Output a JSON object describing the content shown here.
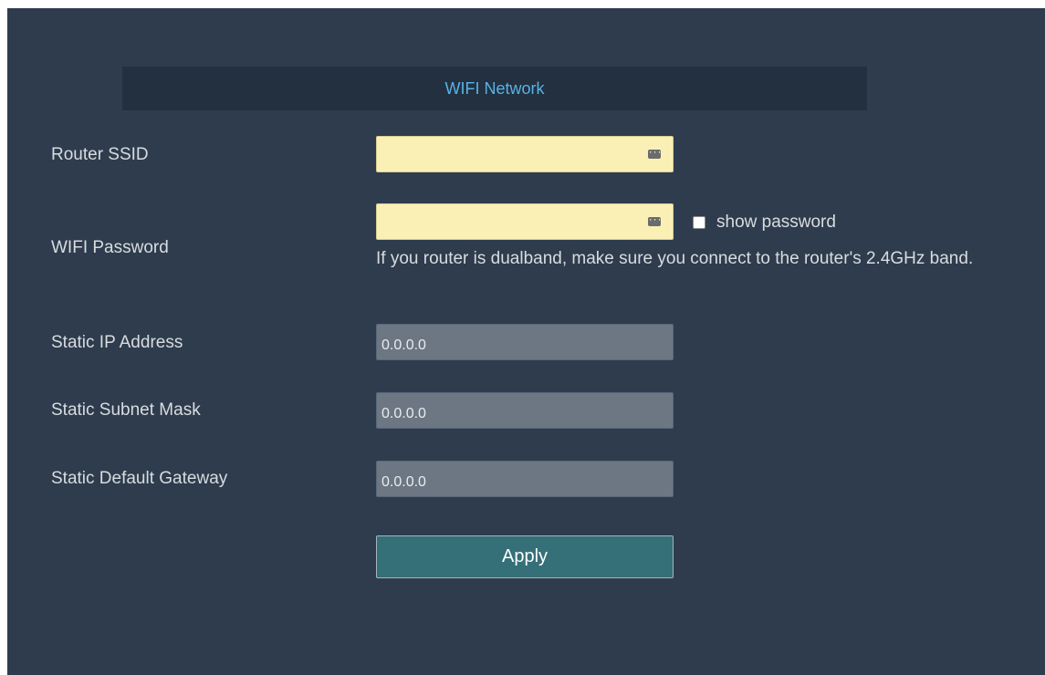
{
  "section": {
    "title": "WIFI Network"
  },
  "fields": {
    "ssid": {
      "label": "Router SSID",
      "value": ""
    },
    "password": {
      "label": "WIFI Password",
      "value": "",
      "show_password_label": "show password",
      "note": "If you router is dualband, make sure you connect to the router's 2.4GHz band."
    },
    "static_ip": {
      "label": "Static IP Address",
      "value": "0.0.0.0"
    },
    "subnet_mask": {
      "label": "Static Subnet Mask",
      "value": "0.0.0.0"
    },
    "gateway": {
      "label": "Static Default Gateway",
      "value": "0.0.0.0"
    }
  },
  "actions": {
    "apply_label": "Apply"
  },
  "icons": {
    "autofill": "password-manager-key-icon"
  },
  "colors": {
    "panel_bg": "#2e3c4d",
    "header_bg": "#22303f",
    "header_text": "#5ab1e6",
    "autofill_bg": "#faf0b6",
    "static_field_bg": "#6c7783",
    "apply_bg": "#356f78"
  }
}
